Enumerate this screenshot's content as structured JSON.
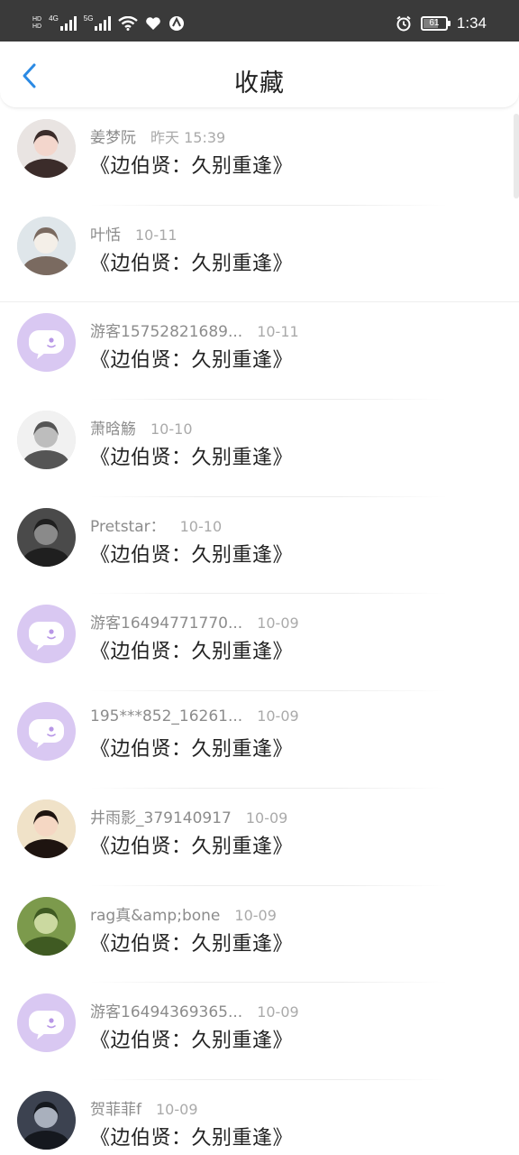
{
  "status_bar": {
    "time": "1:34",
    "battery": "61",
    "net_left": "4G",
    "net_right": "5G"
  },
  "nav": {
    "title": "收藏"
  },
  "colors": {
    "accent": "#2b8ae4",
    "default_avatar": "#d9c8f2"
  },
  "items": [
    {
      "name": "姜梦阮",
      "date": "昨天 15:39",
      "title": "《边伯贤：久别重逢》",
      "avatar": "photo"
    },
    {
      "name": "叶恬",
      "date": "10-11",
      "title": "《边伯贤：久别重逢》",
      "avatar": "photo"
    },
    {
      "name": "游客15752821689...",
      "date": "10-11",
      "title": "《边伯贤：久别重逢》",
      "avatar": "default"
    },
    {
      "name": "萧晗觞",
      "date": "10-10",
      "title": "《边伯贤：久别重逢》",
      "avatar": "photo"
    },
    {
      "name": "Pretstar：",
      "date": "10-10",
      "title": "《边伯贤：久别重逢》",
      "avatar": "photo"
    },
    {
      "name": "游客16494771770...",
      "date": "10-09",
      "title": "《边伯贤：久别重逢》",
      "avatar": "default"
    },
    {
      "name": "195***852_16261...",
      "date": "10-09",
      "title": "《边伯贤：久别重逢》",
      "avatar": "default"
    },
    {
      "name": "井雨影_379140917",
      "date": "10-09",
      "title": "《边伯贤：久别重逢》",
      "avatar": "photo"
    },
    {
      "name": "rag真&amp;bone",
      "date": "10-09",
      "title": "《边伯贤：久别重逢》",
      "avatar": "photo"
    },
    {
      "name": "游客16494369365...",
      "date": "10-09",
      "title": "《边伯贤：久别重逢》",
      "avatar": "default"
    },
    {
      "name": "贺菲菲f",
      "date": "10-09",
      "title": "《边伯贤：久别重逢》",
      "avatar": "photo"
    }
  ]
}
